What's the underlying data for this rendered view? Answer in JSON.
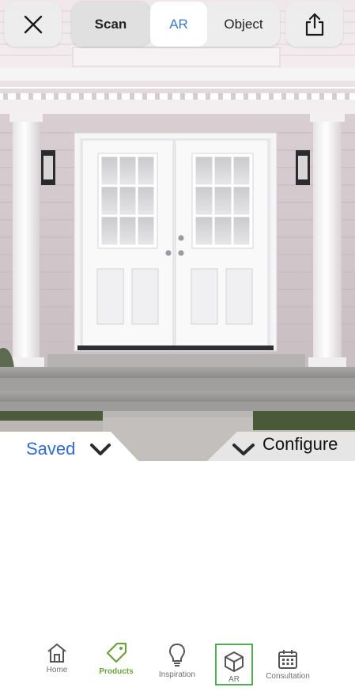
{
  "top_bar": {
    "close_icon": "close-icon",
    "share_icon": "share-icon",
    "modes": [
      "Scan",
      "AR",
      "Object"
    ],
    "active_mode": "AR"
  },
  "sheet_tabs": {
    "saved_label": "Saved",
    "configure_label": "Configure"
  },
  "bottom_nav": {
    "items": [
      {
        "label": "Home",
        "icon": "home-icon"
      },
      {
        "label": "Products",
        "icon": "tag-icon"
      },
      {
        "label": "Inspiration",
        "icon": "lightbulb-icon"
      },
      {
        "label": "AR",
        "icon": "cube-icon"
      },
      {
        "label": "Consultation",
        "icon": "calendar-icon"
      }
    ],
    "active": "Products",
    "highlighted": "AR"
  },
  "colors": {
    "accent_blue": "#2f6ad9",
    "products_green": "#6aa33a",
    "ar_highlight_green": "#4caf50"
  }
}
